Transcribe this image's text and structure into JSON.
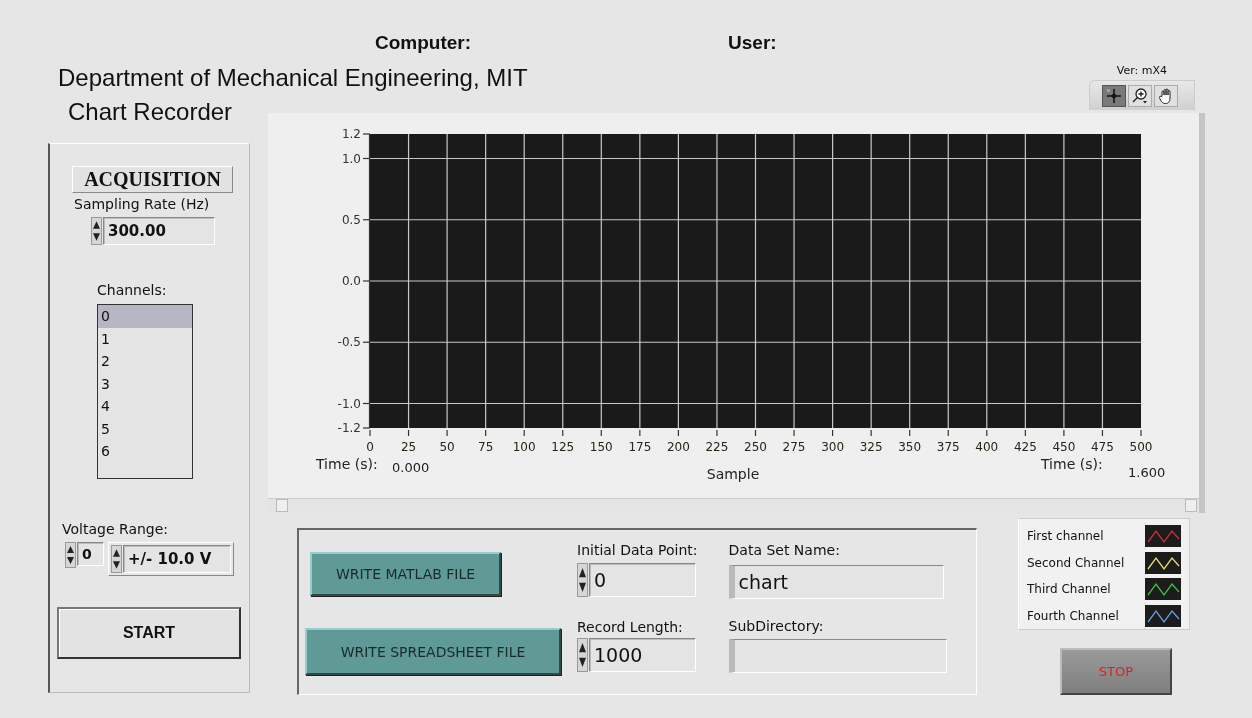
{
  "header": {
    "computer_label": "Computer:",
    "user_label": "User:"
  },
  "title": "Department of Mechanical Engineering, MIT",
  "subtitle": "Chart Recorder",
  "version": "Ver: mX4",
  "tools": [
    {
      "kind": "cursor",
      "selected": true
    },
    {
      "kind": "zoom",
      "selected": false
    },
    {
      "kind": "pan",
      "selected": false
    }
  ],
  "acquisition": {
    "heading": "ACQUISITION",
    "sampling_rate": {
      "label": "Sampling Rate (Hz)",
      "value": "300.00"
    },
    "channels": {
      "label": "Channels:",
      "items": [
        {
          "label": "0",
          "selected": true
        },
        {
          "label": "1",
          "selected": false
        },
        {
          "label": "2",
          "selected": false
        },
        {
          "label": "3",
          "selected": false
        },
        {
          "label": "4",
          "selected": false
        },
        {
          "label": "5",
          "selected": false
        },
        {
          "label": "6",
          "selected": false
        }
      ]
    },
    "voltage_range": {
      "label": "Voltage Range:",
      "index": "0",
      "value": "+/- 10.0 V"
    },
    "start_button": "START"
  },
  "chart": {
    "chart_data": {
      "type": "line",
      "grid": true,
      "xlabel": "Sample",
      "xlim": [
        0,
        500
      ],
      "ylim": [
        -1.2,
        1.2
      ],
      "xticks": [
        0,
        25,
        50,
        75,
        100,
        125,
        150,
        175,
        200,
        225,
        250,
        275,
        300,
        325,
        350,
        375,
        400,
        425,
        450,
        475,
        500
      ],
      "yticks": [
        {
          "value": 1.2,
          "label": "1.2"
        },
        {
          "value": 1,
          "label": "1.0"
        },
        {
          "value": 0.5,
          "label": "0.5"
        },
        {
          "value": 0,
          "label": "0.0"
        },
        {
          "value": -0.5,
          "label": "-0.5"
        },
        {
          "value": -1,
          "label": "-1.0"
        },
        {
          "value": -1.2,
          "label": "-1.2"
        }
      ]
    },
    "start_time": {
      "label": "Time (s):",
      "value": "0.000"
    },
    "end_time": {
      "label": "Time (s):",
      "value": "1.600"
    }
  },
  "output": {
    "buttons": [
      "WRITE MATLAB FILE",
      "WRITE SPREADSHEET FILE"
    ],
    "initial_data_point": {
      "label": "Initial Data Point:",
      "value": "0"
    },
    "record_length": {
      "label": "Record Length:",
      "value": "1000"
    },
    "data_set_name": {
      "label": "Data Set Name:",
      "value": "chart"
    },
    "subdirectory": {
      "label": "SubDirectory:"
    }
  },
  "legend": [
    {
      "name": "First channel",
      "color": "#c8303c"
    },
    {
      "name": "Second Channel",
      "color": "#e8e070"
    },
    {
      "name": "Third Channel",
      "color": "#40c040"
    },
    {
      "name": "Fourth Channel",
      "color": "#60a0e0"
    }
  ],
  "stop_button": "STOP"
}
